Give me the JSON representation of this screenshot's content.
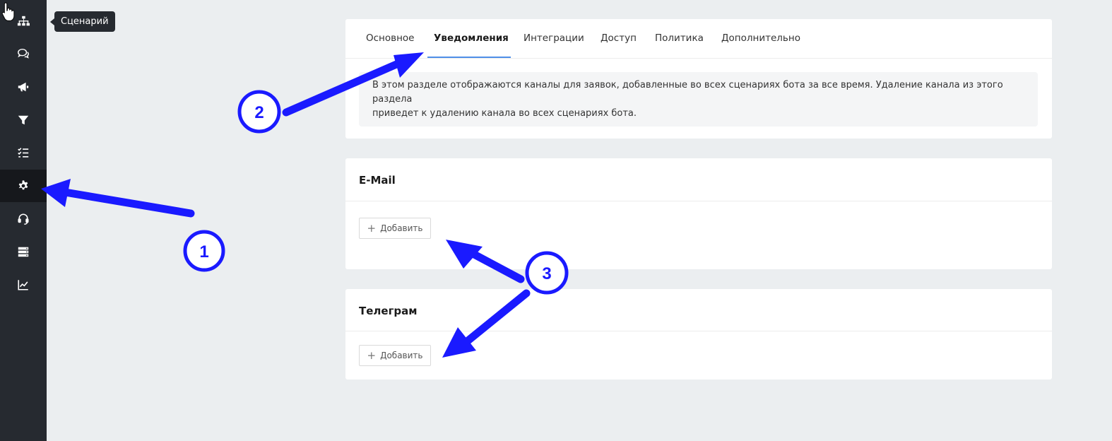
{
  "sidebar": {
    "items": [
      {
        "icon": "sitemap-icon",
        "label": "Сценарий"
      },
      {
        "icon": "chat-icon"
      },
      {
        "icon": "megaphone-icon"
      },
      {
        "icon": "filter-icon"
      },
      {
        "icon": "checklist-icon"
      },
      {
        "icon": "gear-icon",
        "active": true
      },
      {
        "icon": "headset-icon"
      },
      {
        "icon": "server-icon"
      },
      {
        "icon": "chart-line-icon"
      }
    ],
    "tooltip": "Сценарий"
  },
  "settings": {
    "tabs": [
      {
        "label": "Основное"
      },
      {
        "label": "Уведомления",
        "active": true
      },
      {
        "label": "Интеграции"
      },
      {
        "label": "Доступ"
      },
      {
        "label": "Политика"
      },
      {
        "label": "Дополнительно"
      }
    ],
    "info_line1": "В этом разделе отображаются каналы для заявок, добавленные во всех сценариях бота за все время. Удаление канала из этого раздела",
    "info_line2": "приведет к удалению канала во всех сценариях бота."
  },
  "sections": [
    {
      "title": "E-Mail",
      "add_label": "Добавить"
    },
    {
      "title": "Телеграм",
      "add_label": "Добавить"
    }
  ],
  "annotations": {
    "markers": [
      "1",
      "2",
      "3"
    ],
    "color": "#1a1aff"
  },
  "colors": {
    "sidebar_bg": "#262a30",
    "sidebar_active": "#16181c",
    "page_bg": "#ebeef0",
    "tab_ink": "#4f8fe8"
  }
}
